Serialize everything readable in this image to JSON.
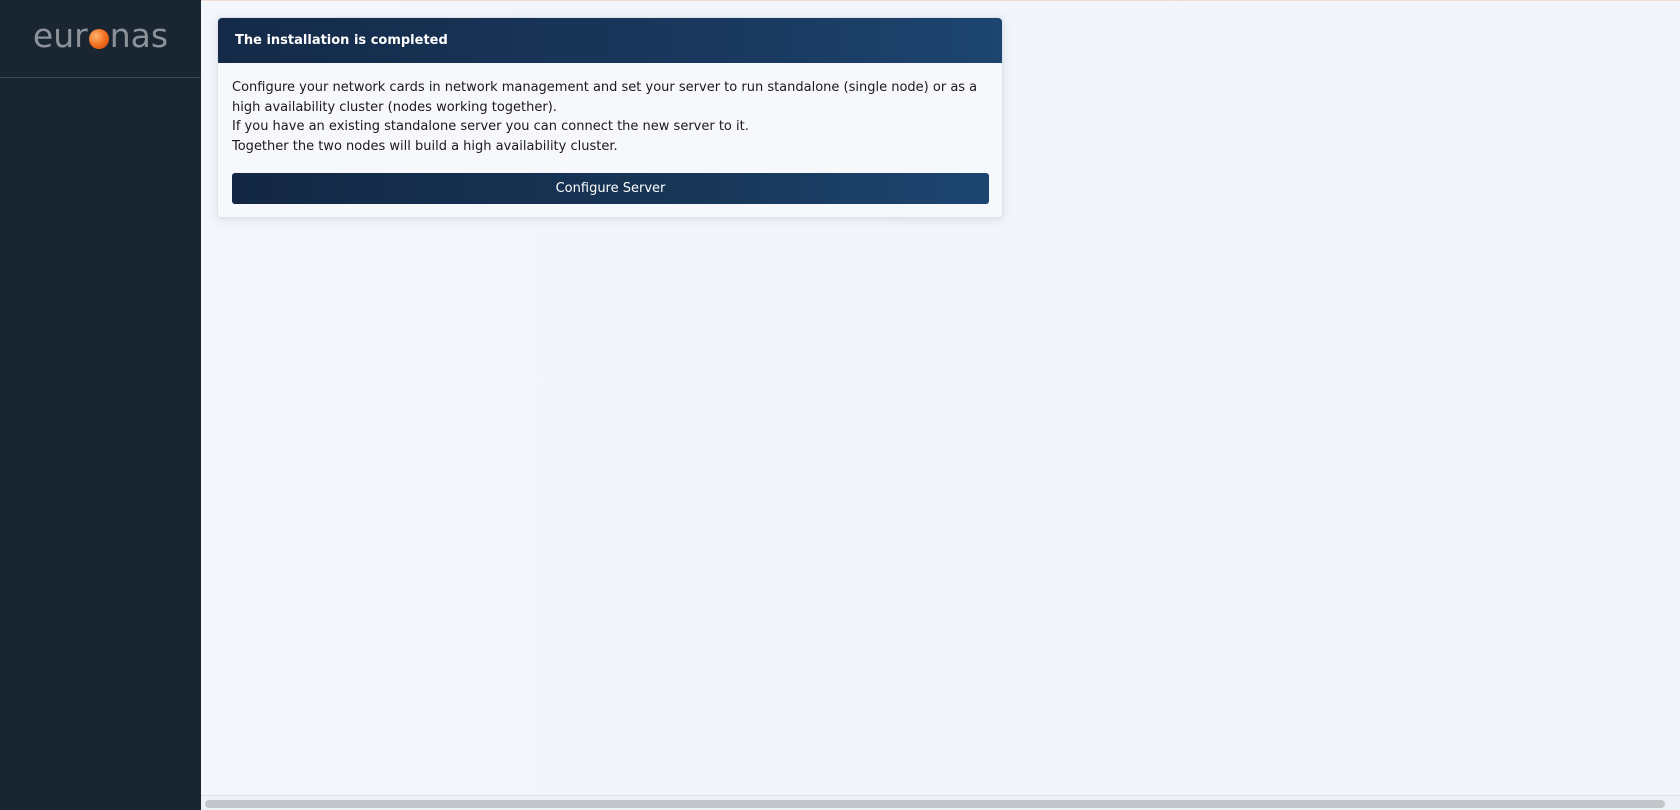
{
  "sidebar": {
    "logo": {
      "text_before": "eur",
      "text_after": "nas",
      "accent_color": "#f06a1c"
    }
  },
  "card": {
    "title": "The installation is completed",
    "paragraphs": [
      "Configure your network cards in network management and set your server to run standalone (single node) or as a high availability cluster (nodes working together).",
      "If you have an existing standalone server you can connect the new server to it.",
      "Together the two nodes will build a high availability cluster."
    ],
    "button_label": "Configure Server"
  },
  "colors": {
    "sidebar_bg": "#1a2532",
    "header_bg": "#142a48",
    "page_bg": "#f1f4f9"
  }
}
